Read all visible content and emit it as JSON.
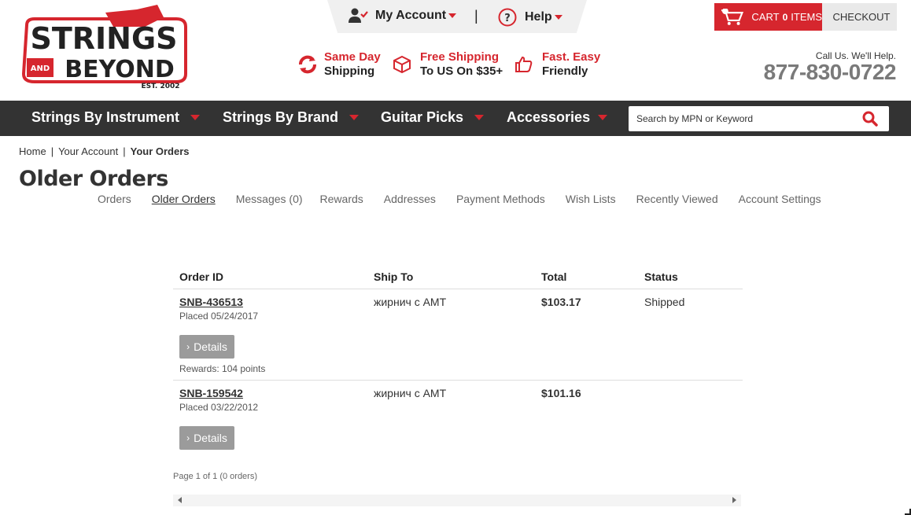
{
  "header": {
    "logo": {
      "line1": "STRINGS",
      "and": "AND",
      "line2": "BEYOND",
      "est": "EST. 2002"
    },
    "account_menu": {
      "my_account": "My Account",
      "separator": "|",
      "help": "Help"
    },
    "features": [
      {
        "icon": "refresh-icon",
        "line1": "Same Day",
        "line2": "Shipping"
      },
      {
        "icon": "box-icon",
        "line1": "Free Shipping",
        "line2": "To US On $35+"
      },
      {
        "icon": "thumbs-up-icon",
        "line1": "Fast. Easy",
        "line2": "Friendly"
      }
    ],
    "cart": {
      "label": "CART",
      "count": "0",
      "items_label": "ITEMS",
      "checkout": "CHECKOUT"
    },
    "call_label": "Call Us. We'll Help.",
    "phone": "877-830-0722"
  },
  "nav": {
    "items": [
      "Strings By Instrument",
      "Strings By Brand",
      "Guitar Picks",
      "Accessories"
    ],
    "search_placeholder": "Search by MPN or Keyword"
  },
  "breadcrumb": {
    "home": "Home",
    "account": "Your Account",
    "current": "Your Orders"
  },
  "page_title": "Older Orders",
  "account_tabs": [
    "Orders",
    "Older Orders",
    "Messages (0)",
    "Rewards",
    "Addresses",
    "Payment Methods",
    "Wish Lists",
    "Recently Viewed",
    "Account Settings"
  ],
  "table": {
    "headers": {
      "order_id": "Order ID",
      "ship_to": "Ship To",
      "total": "Total",
      "status": "Status"
    },
    "rows": [
      {
        "order_id": "SNB-436513",
        "placed": "Placed 05/24/2017",
        "details": "Details",
        "rewards": "Rewards: 104 points",
        "ship_to": "жирнич с АМТ",
        "total": "$103.17",
        "status": "Shipped"
      },
      {
        "order_id": "SNB-159542",
        "placed": "Placed 03/22/2012",
        "details": "Details",
        "rewards": "",
        "ship_to": "жирнич с АМТ",
        "total": "$101.16",
        "status": ""
      }
    ]
  },
  "pager": "Page 1 of 1 (0 orders)",
  "colors": {
    "brand_red": "#d6262e",
    "nav_bg": "#333333",
    "details_bg": "#9b9b9b"
  }
}
